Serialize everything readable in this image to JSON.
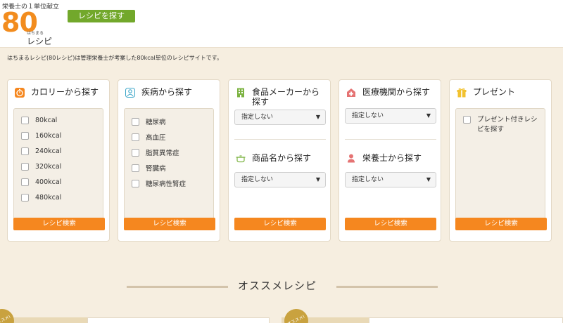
{
  "header": {
    "logo_top": "栄養士の１単位献立",
    "logo_number": "80",
    "logo_hachi": "はちまる",
    "logo_recipe": "レシピ",
    "search_button": "レシピを探す"
  },
  "tagline": "はちまるレシピ(80レシピ)は管理栄養士が考案した80kcal単位のレシピサイトです。",
  "cards": {
    "calorie": {
      "title": "カロリーから探す",
      "options": [
        "80kcal",
        "160kcal",
        "240kcal",
        "320kcal",
        "400kcal",
        "480kcal"
      ],
      "button": "レシピ検索"
    },
    "disease": {
      "title": "疾病から探す",
      "options": [
        "糖尿病",
        "高血圧",
        "脂質異常症",
        "腎臓病",
        "糖尿病性腎症"
      ],
      "button": "レシピ検索"
    },
    "food": {
      "title": "食品メーカーから探す",
      "select": "指定しない",
      "sub_title": "商品名から探す",
      "sub_select": "指定しない",
      "button": "レシピ検索"
    },
    "medical": {
      "title": "医療機関から探す",
      "select": "指定しない",
      "sub_title": "栄養士から探す",
      "sub_select": "指定しない",
      "button": "レシピ検索"
    },
    "present": {
      "title": "プレゼント",
      "option": "プレゼント付きレシピを探す",
      "button": "レシピ検索"
    }
  },
  "recommended": {
    "title": "オススメレシピ",
    "badge": "オススメ!"
  },
  "colors": {
    "accent_orange": "#f5871f",
    "accent_green": "#72a82b",
    "background": "#f6eee0"
  }
}
